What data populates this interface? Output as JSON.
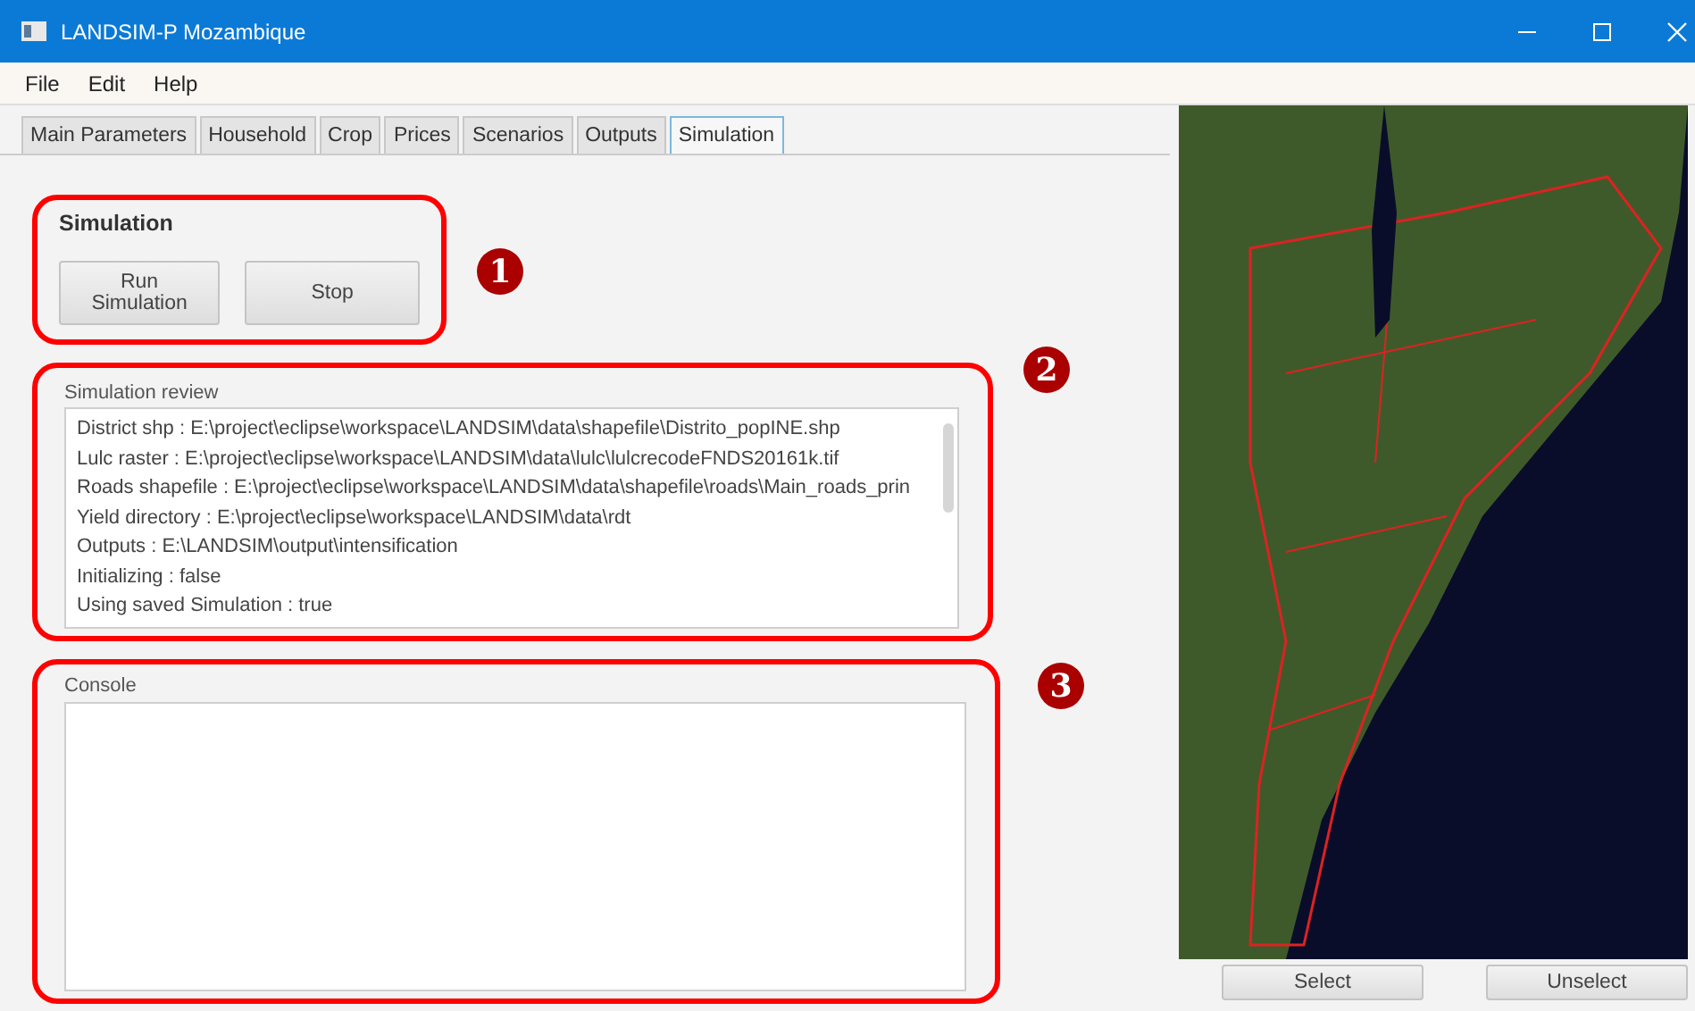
{
  "window": {
    "title": "LANDSIM-P Mozambique"
  },
  "menu": [
    "File",
    "Edit",
    "Help"
  ],
  "tabs": [
    {
      "label": "Main Parameters",
      "selected": false
    },
    {
      "label": "Household",
      "selected": false
    },
    {
      "label": "Crop",
      "selected": false
    },
    {
      "label": "Prices",
      "selected": false
    },
    {
      "label": "Scenarios",
      "selected": false
    },
    {
      "label": "Outputs",
      "selected": false
    },
    {
      "label": "Simulation",
      "selected": true
    }
  ],
  "simulation": {
    "heading": "Simulation",
    "buttons": [
      "Run Simulation",
      "Stop"
    ],
    "callout": "1"
  },
  "review": {
    "label": "Simulation review",
    "callout": "2",
    "lines": [
      "District shp : E:\\project\\eclipse\\workspace\\LANDSIM\\data\\shapefile\\Distrito_popINE.shp",
      "Lulc raster : E:\\project\\eclipse\\workspace\\LANDSIM\\data\\lulc\\lulcrecodeFNDS20161k.tif",
      "Roads shapefile : E:\\project\\eclipse\\workspace\\LANDSIM\\data\\shapefile\\roads\\Main_roads_prin",
      "Yield directory : E:\\project\\eclipse\\workspace\\LANDSIM\\data\\rdt",
      "Outputs : E:\\LANDSIM\\output\\intensification",
      "Initializing : false",
      "Using saved Simulation : true"
    ]
  },
  "console": {
    "label": "Console",
    "callout": "3"
  },
  "map_buttons": [
    "Select",
    "Unselect"
  ]
}
